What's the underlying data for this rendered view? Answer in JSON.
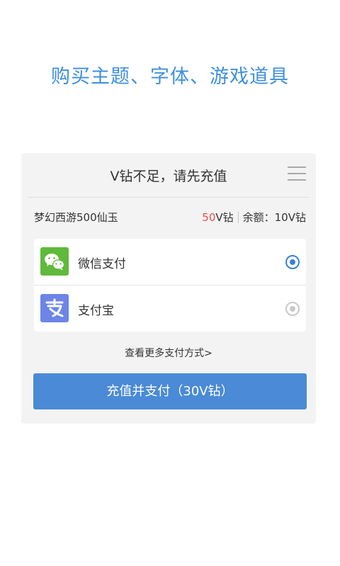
{
  "headline": "购买主题、字体、游戏道具",
  "dialog": {
    "title": "V钻不足，请先充值",
    "product_name": "梦幻西游500仙玉",
    "price_amount": "50",
    "price_unit": "V钻",
    "balance": "余额：10V钻",
    "payment_methods": [
      {
        "label": "微信支付",
        "icon": "wechat-pay-icon",
        "selected": true,
        "color": "#5fb93b"
      },
      {
        "label": "支付宝",
        "icon": "alipay-icon",
        "selected": false,
        "color": "#6c85e6"
      }
    ],
    "more_link": "查看更多支付方式>",
    "pay_button": "充值并支付（30V钻）"
  },
  "colors": {
    "accent": "#4a8ad6",
    "headline": "#3f8fdd",
    "price": "#ee4b4b"
  }
}
